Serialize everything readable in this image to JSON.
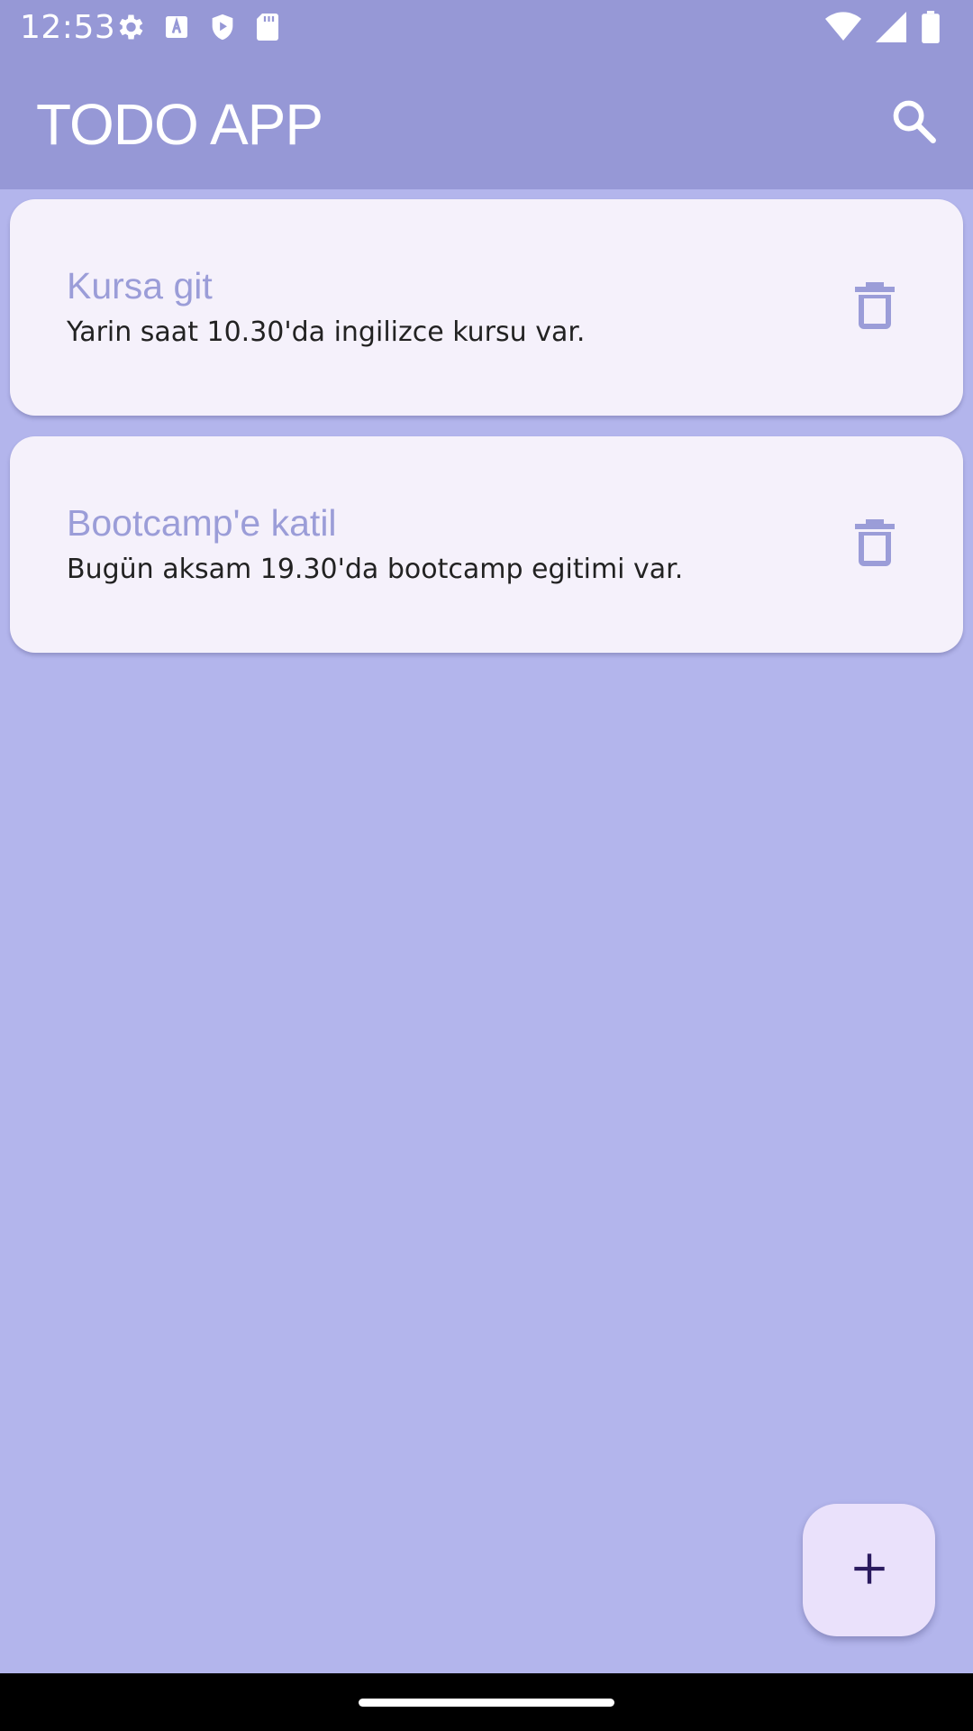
{
  "status_bar": {
    "time": "12:53",
    "left_icons": [
      "gear-icon",
      "font-a-icon",
      "shield-play-icon",
      "sd-card-icon"
    ],
    "right_icons": [
      "wifi-icon",
      "signal-icon",
      "battery-icon"
    ]
  },
  "app_bar": {
    "title": "TODO APP",
    "search_icon": "search-icon"
  },
  "todos": [
    {
      "title": "Kursa git",
      "description": "Yarin saat 10.30'da ingilizce kursu var.",
      "delete_icon": "trash-icon"
    },
    {
      "title": "Bootcamp'e katil",
      "description": "Bugün aksam 19.30'da bootcamp egitimi var.",
      "delete_icon": "trash-icon"
    }
  ],
  "fab": {
    "icon": "plus-icon"
  },
  "colors": {
    "app_bar": "#9698d6",
    "background": "#b3b5ec",
    "card": "#f5f1fb",
    "card_title": "#9b9dd8",
    "fab": "#eae1fb",
    "fab_icon": "#2a1a5e"
  }
}
